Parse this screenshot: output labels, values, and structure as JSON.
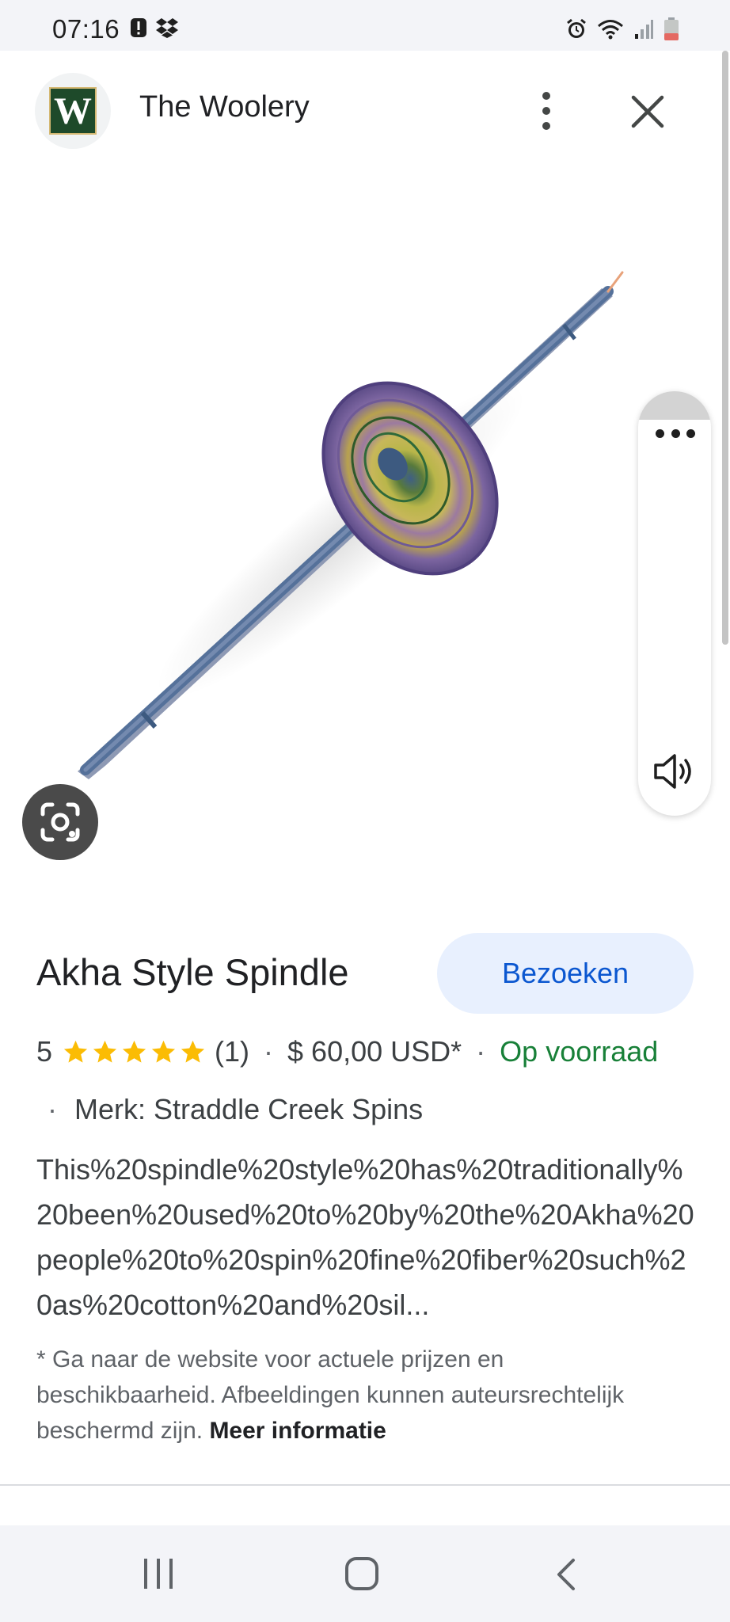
{
  "status_bar": {
    "time": "07:16",
    "icons_left": [
      "alert-icon",
      "dropbox-icon"
    ],
    "icons_right": [
      "alarm-icon",
      "wifi-icon",
      "signal-icon",
      "battery-low-icon"
    ]
  },
  "header": {
    "logo_letter": "W",
    "site_name": "The Woolery",
    "more_icon": "more-vert-icon",
    "close_icon": "close-icon"
  },
  "image_panel": {
    "lens_icon": "google-lens-icon",
    "side_panel_icon": "more-horiz-icon",
    "volume_icon": "volume-icon"
  },
  "product": {
    "title": "Akha Style Spindle",
    "visit_label": "Bezoeken",
    "rating": "5",
    "rating_stars": 5,
    "review_count": "(1)",
    "separator": "·",
    "price": "$ 60,00 USD*",
    "availability": "Op voorraad",
    "brand": "Merk: Straddle Creek Spins",
    "description": "This%20spindle%20style%20has%20traditionally%20been%20used%20to%20by%20the%20Akha%20people%20to%20spin%20fine%20fiber%20such%20as%20cotton%20and%20sil..."
  },
  "disclaimer": {
    "text": "* Ga naar de website voor actuele prijzen en beschikbaarheid. Afbeeldingen kunnen auteursrechtelijk beschermd zijn.",
    "more_info": "Meer informatie"
  },
  "colors": {
    "accent_blue": "#0b57d0",
    "visit_button_bg": "#e8f0fe",
    "in_stock_green": "#188038",
    "star_yellow": "#fbbc04",
    "logo_green": "#1e4a2a"
  },
  "nav_bar": {
    "recents_icon": "recents-icon",
    "home_icon": "home-icon",
    "back_icon": "back-icon"
  }
}
